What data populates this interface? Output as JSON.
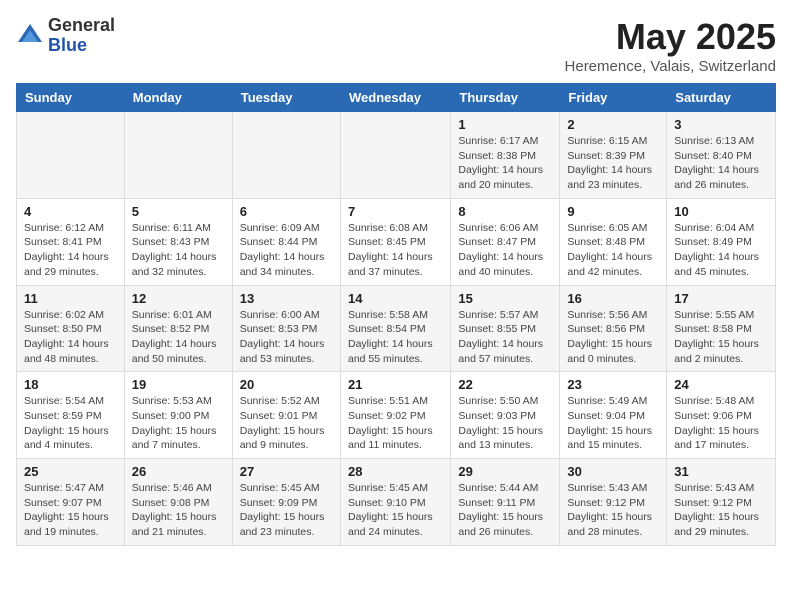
{
  "header": {
    "logo_general": "General",
    "logo_blue": "Blue",
    "month_title": "May 2025",
    "location": "Heremence, Valais, Switzerland"
  },
  "days_of_week": [
    "Sunday",
    "Monday",
    "Tuesday",
    "Wednesday",
    "Thursday",
    "Friday",
    "Saturday"
  ],
  "weeks": [
    [
      {
        "day": "",
        "info": ""
      },
      {
        "day": "",
        "info": ""
      },
      {
        "day": "",
        "info": ""
      },
      {
        "day": "",
        "info": ""
      },
      {
        "day": "1",
        "info": "Sunrise: 6:17 AM\nSunset: 8:38 PM\nDaylight: 14 hours\nand 20 minutes."
      },
      {
        "day": "2",
        "info": "Sunrise: 6:15 AM\nSunset: 8:39 PM\nDaylight: 14 hours\nand 23 minutes."
      },
      {
        "day": "3",
        "info": "Sunrise: 6:13 AM\nSunset: 8:40 PM\nDaylight: 14 hours\nand 26 minutes."
      }
    ],
    [
      {
        "day": "4",
        "info": "Sunrise: 6:12 AM\nSunset: 8:41 PM\nDaylight: 14 hours\nand 29 minutes."
      },
      {
        "day": "5",
        "info": "Sunrise: 6:11 AM\nSunset: 8:43 PM\nDaylight: 14 hours\nand 32 minutes."
      },
      {
        "day": "6",
        "info": "Sunrise: 6:09 AM\nSunset: 8:44 PM\nDaylight: 14 hours\nand 34 minutes."
      },
      {
        "day": "7",
        "info": "Sunrise: 6:08 AM\nSunset: 8:45 PM\nDaylight: 14 hours\nand 37 minutes."
      },
      {
        "day": "8",
        "info": "Sunrise: 6:06 AM\nSunset: 8:47 PM\nDaylight: 14 hours\nand 40 minutes."
      },
      {
        "day": "9",
        "info": "Sunrise: 6:05 AM\nSunset: 8:48 PM\nDaylight: 14 hours\nand 42 minutes."
      },
      {
        "day": "10",
        "info": "Sunrise: 6:04 AM\nSunset: 8:49 PM\nDaylight: 14 hours\nand 45 minutes."
      }
    ],
    [
      {
        "day": "11",
        "info": "Sunrise: 6:02 AM\nSunset: 8:50 PM\nDaylight: 14 hours\nand 48 minutes."
      },
      {
        "day": "12",
        "info": "Sunrise: 6:01 AM\nSunset: 8:52 PM\nDaylight: 14 hours\nand 50 minutes."
      },
      {
        "day": "13",
        "info": "Sunrise: 6:00 AM\nSunset: 8:53 PM\nDaylight: 14 hours\nand 53 minutes."
      },
      {
        "day": "14",
        "info": "Sunrise: 5:58 AM\nSunset: 8:54 PM\nDaylight: 14 hours\nand 55 minutes."
      },
      {
        "day": "15",
        "info": "Sunrise: 5:57 AM\nSunset: 8:55 PM\nDaylight: 14 hours\nand 57 minutes."
      },
      {
        "day": "16",
        "info": "Sunrise: 5:56 AM\nSunset: 8:56 PM\nDaylight: 15 hours\nand 0 minutes."
      },
      {
        "day": "17",
        "info": "Sunrise: 5:55 AM\nSunset: 8:58 PM\nDaylight: 15 hours\nand 2 minutes."
      }
    ],
    [
      {
        "day": "18",
        "info": "Sunrise: 5:54 AM\nSunset: 8:59 PM\nDaylight: 15 hours\nand 4 minutes."
      },
      {
        "day": "19",
        "info": "Sunrise: 5:53 AM\nSunset: 9:00 PM\nDaylight: 15 hours\nand 7 minutes."
      },
      {
        "day": "20",
        "info": "Sunrise: 5:52 AM\nSunset: 9:01 PM\nDaylight: 15 hours\nand 9 minutes."
      },
      {
        "day": "21",
        "info": "Sunrise: 5:51 AM\nSunset: 9:02 PM\nDaylight: 15 hours\nand 11 minutes."
      },
      {
        "day": "22",
        "info": "Sunrise: 5:50 AM\nSunset: 9:03 PM\nDaylight: 15 hours\nand 13 minutes."
      },
      {
        "day": "23",
        "info": "Sunrise: 5:49 AM\nSunset: 9:04 PM\nDaylight: 15 hours\nand 15 minutes."
      },
      {
        "day": "24",
        "info": "Sunrise: 5:48 AM\nSunset: 9:06 PM\nDaylight: 15 hours\nand 17 minutes."
      }
    ],
    [
      {
        "day": "25",
        "info": "Sunrise: 5:47 AM\nSunset: 9:07 PM\nDaylight: 15 hours\nand 19 minutes."
      },
      {
        "day": "26",
        "info": "Sunrise: 5:46 AM\nSunset: 9:08 PM\nDaylight: 15 hours\nand 21 minutes."
      },
      {
        "day": "27",
        "info": "Sunrise: 5:45 AM\nSunset: 9:09 PM\nDaylight: 15 hours\nand 23 minutes."
      },
      {
        "day": "28",
        "info": "Sunrise: 5:45 AM\nSunset: 9:10 PM\nDaylight: 15 hours\nand 24 minutes."
      },
      {
        "day": "29",
        "info": "Sunrise: 5:44 AM\nSunset: 9:11 PM\nDaylight: 15 hours\nand 26 minutes."
      },
      {
        "day": "30",
        "info": "Sunrise: 5:43 AM\nSunset: 9:12 PM\nDaylight: 15 hours\nand 28 minutes."
      },
      {
        "day": "31",
        "info": "Sunrise: 5:43 AM\nSunset: 9:12 PM\nDaylight: 15 hours\nand 29 minutes."
      }
    ]
  ]
}
